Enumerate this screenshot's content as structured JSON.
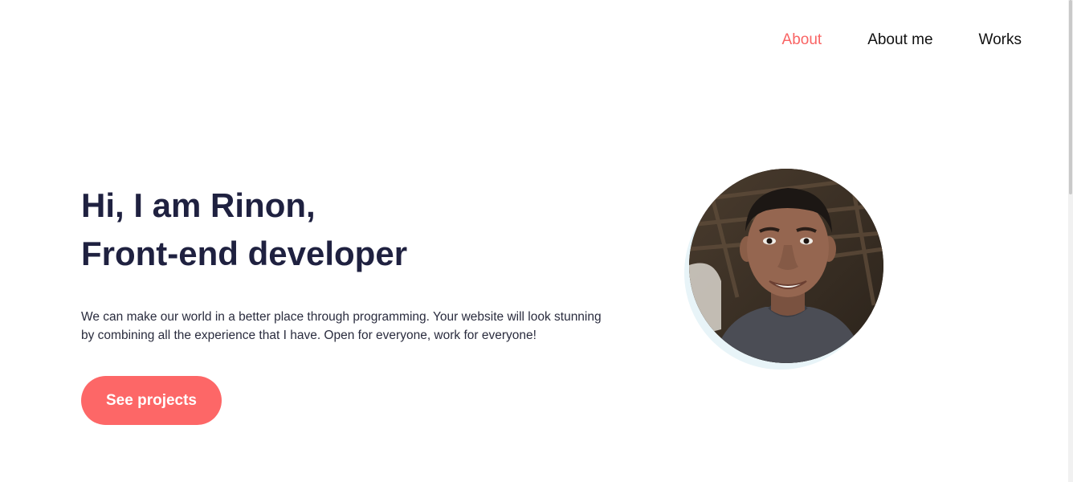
{
  "nav": {
    "items": [
      {
        "label": "About",
        "active": true
      },
      {
        "label": "About me",
        "active": false
      },
      {
        "label": "Works",
        "active": false
      }
    ]
  },
  "hero": {
    "headline_line1": "Hi, I am Rinon,",
    "headline_line2": "Front-end developer",
    "intro": "We can make our world in a better place through programming. Your website will look stunning by combining all the experience that I have. Open for everyone, work for everyone!",
    "cta_label": "See projects"
  },
  "colors": {
    "accent": "#f96464",
    "button": "#fd6767",
    "heading": "#1f2140",
    "text": "#2a2c3e"
  },
  "portrait": {
    "icon": "person-photo"
  }
}
